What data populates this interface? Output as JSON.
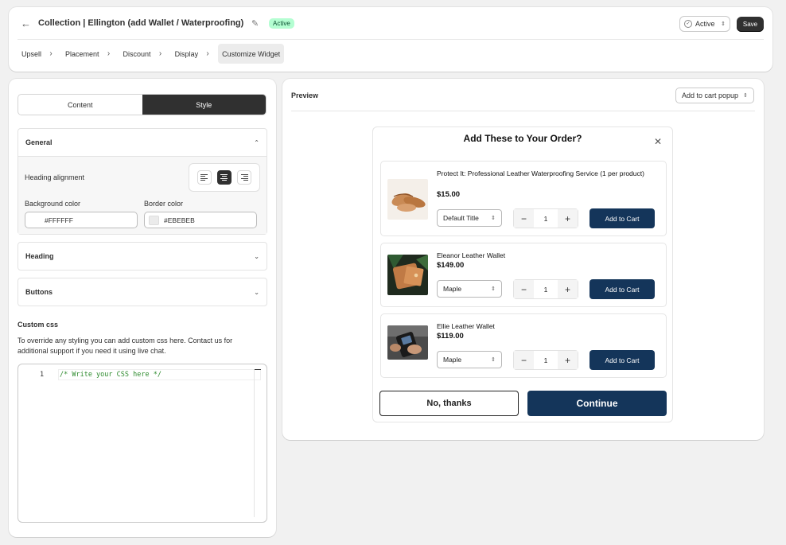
{
  "header": {
    "title": "Collection | Ellington (add Wallet / Waterproofing)",
    "status_badge": "Active",
    "status_select": "Active",
    "save_label": "Save",
    "steps": [
      "Upsell",
      "Placement",
      "Discount",
      "Display",
      "Customize Widget"
    ]
  },
  "editor": {
    "tabs": [
      "Content",
      "Style"
    ],
    "active_tab": "Style",
    "general": {
      "title": "General",
      "heading_alignment_label": "Heading alignment",
      "alignment_selected": "center",
      "background_color_label": "Background color",
      "background_color": "#FFFFFF",
      "border_color_label": "Border color",
      "border_color": "#EBEBEB"
    },
    "heading_section": "Heading",
    "buttons_section": "Buttons",
    "custom_css": {
      "title": "Custom css",
      "help": "To override any styling you can add custom css here. Contact us for additional support if you need it using live chat.",
      "line_number": "1",
      "code": "/* Write your CSS here */"
    }
  },
  "preview": {
    "label": "Preview",
    "mode": "Add to cart popup",
    "popup": {
      "title": "Add These to Your Order?",
      "items": [
        {
          "name": "Protect It: Professional Leather Waterproofing Service (1 per product)",
          "price": "$15.00",
          "variant": "Default Title",
          "qty": "1",
          "button": "Add to Cart"
        },
        {
          "name": "Eleanor Leather Wallet",
          "price": "$149.00",
          "variant": "Maple",
          "qty": "1",
          "button": "Add to Cart"
        },
        {
          "name": "Ellie Leather Wallet",
          "price": "$119.00",
          "variant": "Maple",
          "qty": "1",
          "button": "Add to Cart"
        }
      ],
      "decline_label": "No, thanks",
      "continue_label": "Continue"
    }
  },
  "colors": {
    "primary_dark": "#303030",
    "popup_button": "#14355a",
    "badge_bg": "#b4fed2",
    "badge_text": "#0c5132"
  }
}
